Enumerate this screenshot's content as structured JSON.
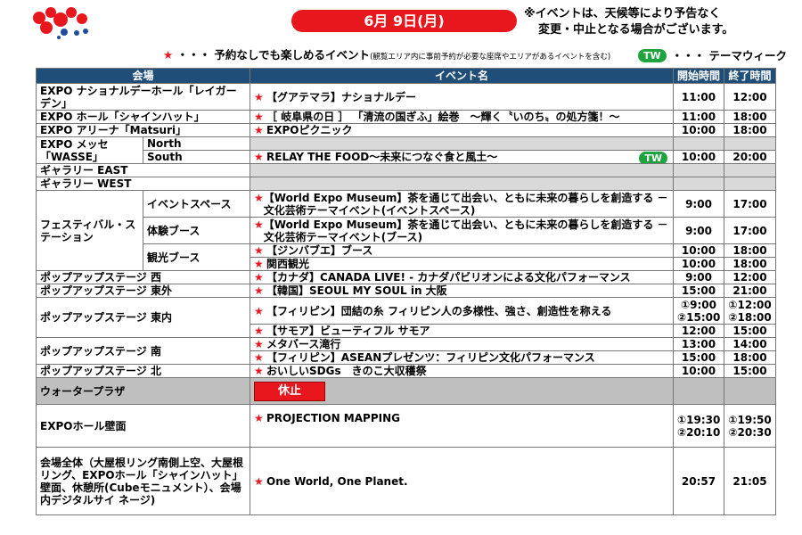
{
  "header": {
    "date": "6月 9日(月)",
    "notice_line1": "※イベントは、天候等により予告なく",
    "notice_line2": "変更・中止となる場合がございます。"
  },
  "legend": {
    "star_symbol": "★",
    "star_text": "・・・ 予約なしでも楽しめるイベント",
    "star_note": "(観覧エリア内に事前予約が必要な座席やエリアがあるイベントを含む)",
    "tw_badge": "TW",
    "tw_text": "・・・ テーマウィーク"
  },
  "table": {
    "col_venue": "会場",
    "col_event": "イベント名",
    "col_start": "開始時間",
    "col_end": "終了時間",
    "rows": [
      {
        "venue": "EXPO ナショナルデーホール「レイガーデン」",
        "event": "【グアテマラ】ナショナルデー",
        "start": "11:00",
        "end": "12:00"
      },
      {
        "venue": "EXPO ホール「シャインハット」",
        "event": "［ 岐阜県の日 ］ 「清流の国ぎふ」絵巻　～輝く〝いのち〟の処方箋！～",
        "start": "11:00",
        "end": "18:00"
      },
      {
        "venue": "EXPO アリーナ「Matsuri」",
        "event": "EXPOピクニック",
        "start": "10:00",
        "end": "18:00"
      },
      {
        "venue": "EXPO メッセ「WASSE」",
        "sub1": "North",
        "sub2": "South",
        "event": "RELAY THE FOOD～未来につなぐ食と風土～",
        "start": "10:00",
        "end": "20:00"
      },
      {
        "venue": "ギャラリー EAST"
      },
      {
        "venue": "ギャラリー WEST"
      },
      {
        "venue": "フェスティバル・ステーション",
        "sub": "イベントスペース",
        "event": "【World Expo Museum】茶を通じて出会い、ともに未来の暮らしを創造する － 文化芸術テーマイベント(イベントスペース)",
        "start": "9:00",
        "end": "17:00"
      },
      {
        "sub": "体験ブース",
        "event": "【World Expo Museum】茶を通じて出会い、ともに未来の暮らしを創造する － 文化芸術テーマイベント(ブース)",
        "start": "9:00",
        "end": "17:00"
      },
      {
        "sub": "観光ブース",
        "event": "【ジンバブエ】ブース",
        "start": "10:00",
        "end": "18:00"
      },
      {
        "event": "関西観光",
        "start": "10:00",
        "end": "18:00"
      },
      {
        "venue": "ポップアップステージ 西",
        "event": "【カナダ】CANADA LIVE! - カナダパビリオンによる文化パフォーマンス",
        "start": "9:00",
        "end": "12:00"
      },
      {
        "venue": "ポップアップステージ 東外",
        "event": "【韓国】SEOUL MY SOUL in 大阪",
        "start": "15:00",
        "end": "21:00"
      },
      {
        "venue": "ポップアップステージ 東内",
        "event": "【フィリピン】団結の糸 フィリピン人の多様性、強さ、創造性を称える",
        "start1": "①9:00",
        "end1": "①12:00",
        "start2": "②15:00",
        "end2": "②18:00"
      },
      {
        "event": "【サモア】ビューティフル サモア",
        "start": "12:00",
        "end": "15:00"
      },
      {
        "venue": "ポップアップステージ 南",
        "event": "メタバース滝行",
        "start": "13:00",
        "end": "14:00"
      },
      {
        "event": "【フィリピン】ASEANプレゼンツ：フィリピン文化パフォーマンス",
        "start": "15:00",
        "end": "18:00"
      },
      {
        "venue": "ポップアップステージ 北",
        "event": "おいしいSDGs　きのこ大収穫祭",
        "start": "10:00",
        "end": "15:00"
      },
      {
        "venue": "ウォータープラザ",
        "closed": "休止"
      },
      {
        "venue": "EXPOホール壁面",
        "event": "PROJECTION MAPPING",
        "start1": "①19:30",
        "end1": "①19:50",
        "start2": "②20:10",
        "end2": "②20:30"
      },
      {
        "venue": "会場全体（大屋根リング南側上空、大屋根リング、EXPOホール「シャインハット」壁面、休憩所(Cubeモニュメント）、会場内デジタルサイ ネージ)",
        "event": "One World, One Planet.",
        "start": "20:57",
        "end": "21:05"
      }
    ]
  },
  "colors": {
    "accent_red": "#e8161d",
    "header_blue": "#1f4e79",
    "tw_green": "#1ea33f",
    "gray": "#d9d9d9"
  }
}
